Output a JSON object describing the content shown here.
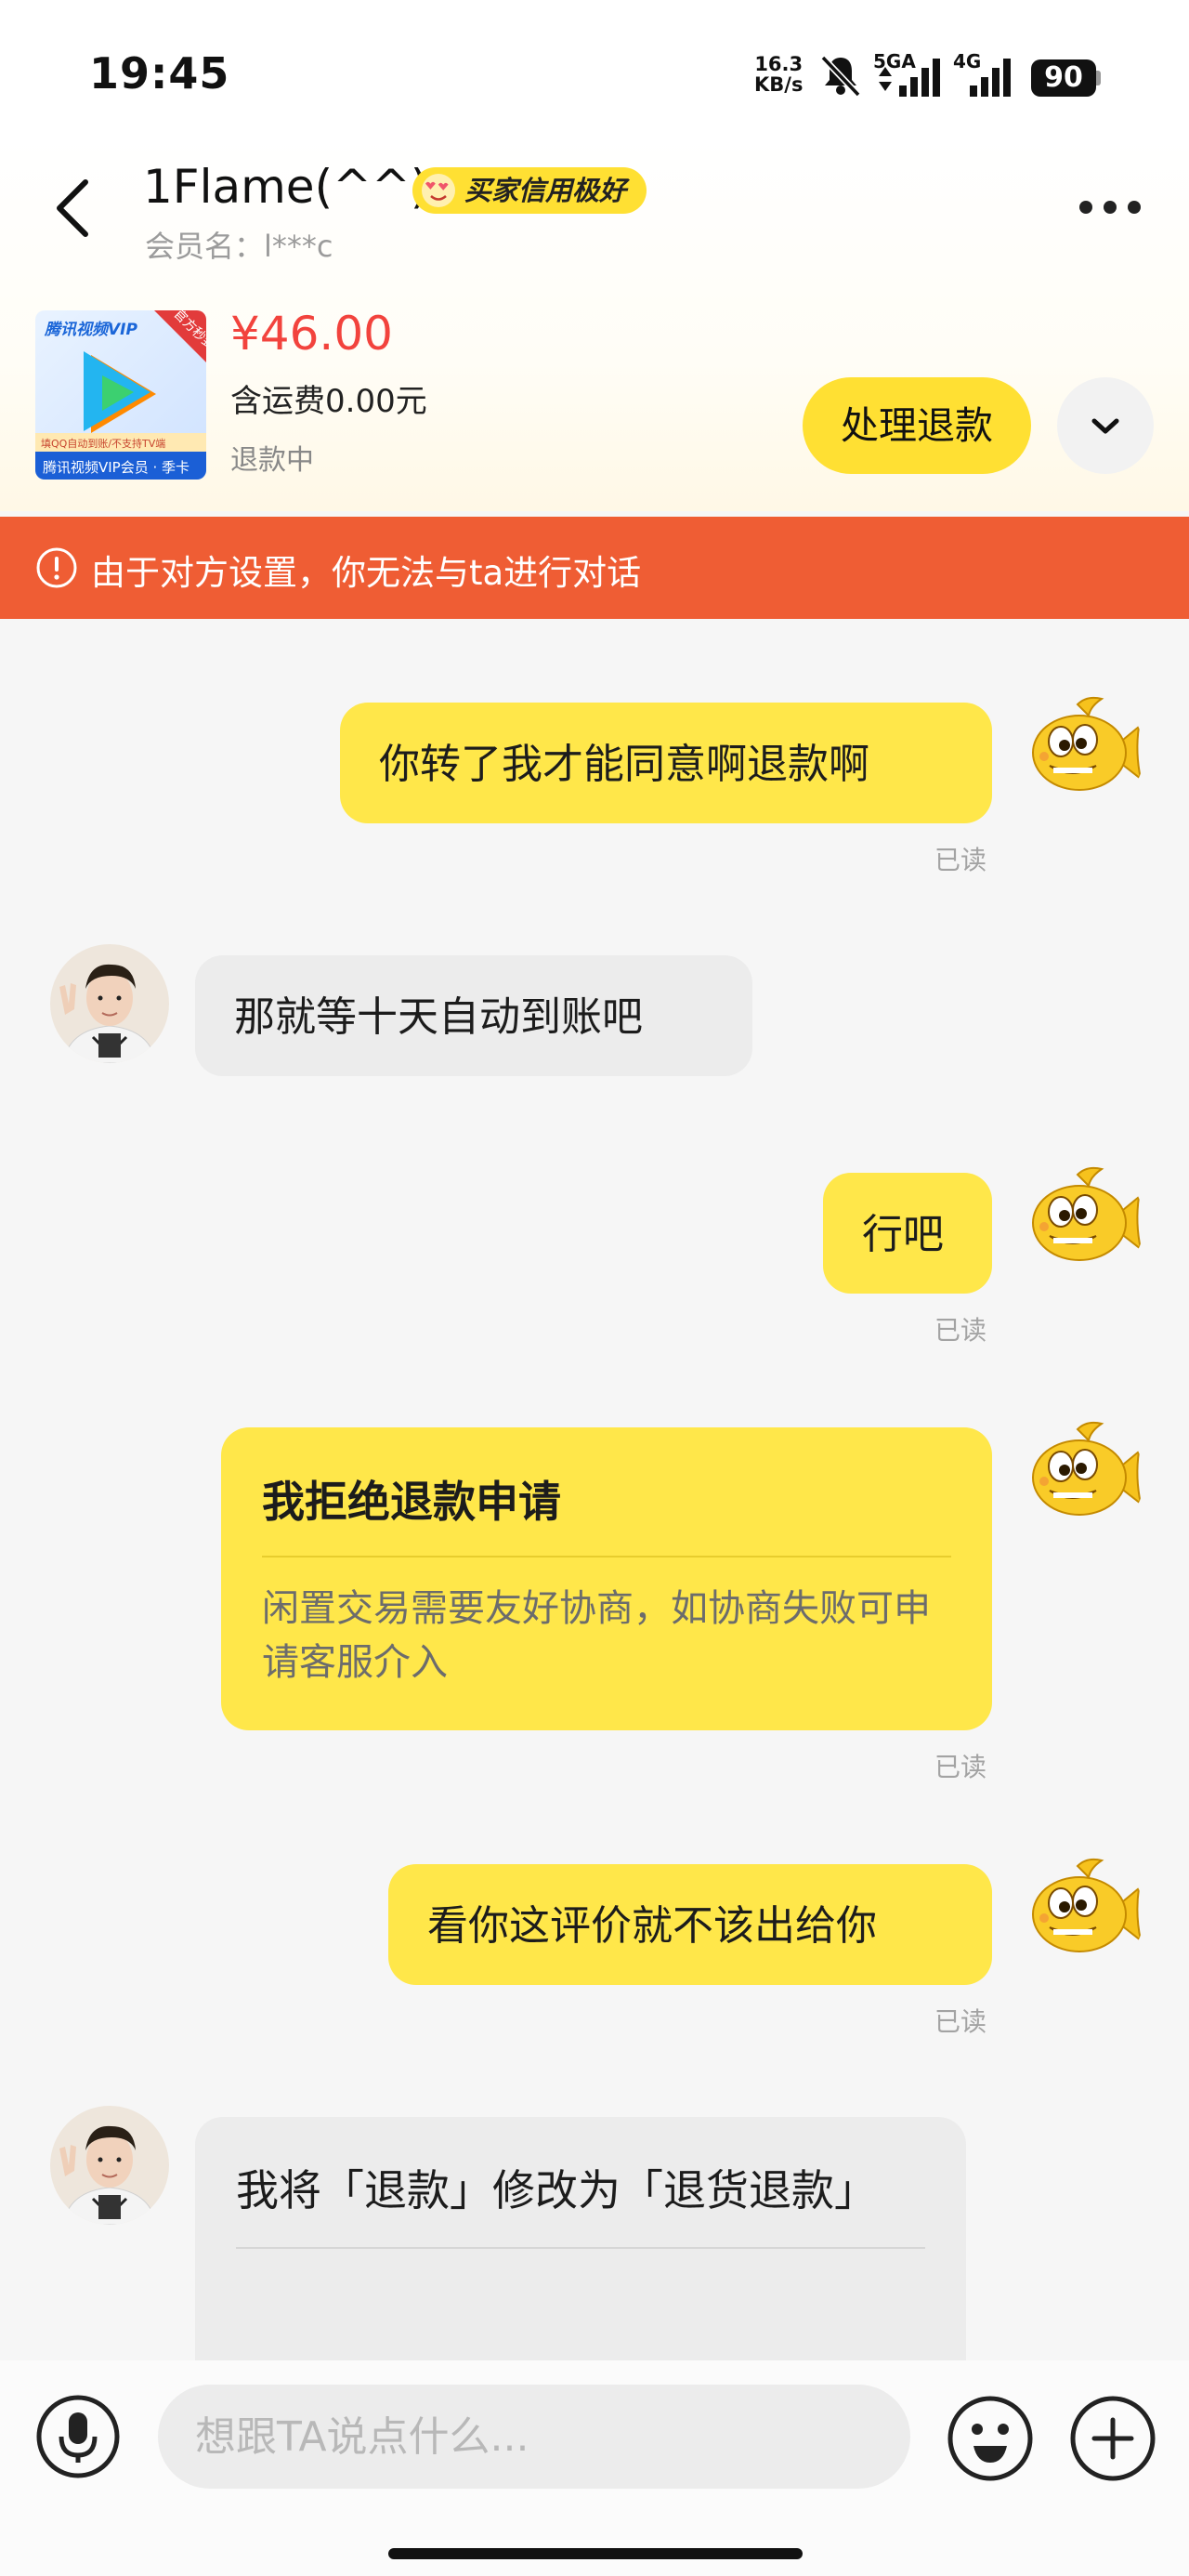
{
  "status_bar": {
    "time": "19:45",
    "net_speed_value": "16.3",
    "net_speed_unit": "KB/s",
    "network_1": "5GA",
    "network_2": "4G",
    "battery": "90"
  },
  "header": {
    "name": "1Flame(^^)",
    "credit_badge": "买家信用极好",
    "member_label": "会员名：l***c"
  },
  "product": {
    "price": "¥46.00",
    "shipping": "含运费0.00元",
    "status": "退款中",
    "thumb_brand": "腾讯视频VIP",
    "thumb_corner": "官方秒到",
    "thumb_note": "填QQ自动到账/不支持TV端",
    "thumb_caption": "腾讯视频VIP会员 · 季卡",
    "handle_button": "处理退款"
  },
  "banner": {
    "text": "由于对方设置，你无法与ta进行对话"
  },
  "messages": {
    "m1": {
      "text": "你转了我才能同意啊退款啊",
      "status": "已读"
    },
    "m2": {
      "text": "那就等十天自动到账吧"
    },
    "m3": {
      "text": "行吧",
      "status": "已读"
    },
    "m4": {
      "title": "我拒绝退款申请",
      "body": "闲置交易需要友好协商，如协商失败可申请客服介入",
      "status": "已读"
    },
    "m5": {
      "text": "看你这评价就不该出给你",
      "status": "已读"
    },
    "m6": {
      "title": "我将「退款」修改为「退货退款」"
    }
  },
  "input": {
    "placeholder": "想跟TA说点什么..."
  },
  "colors": {
    "accent_yellow": "#ffe033",
    "bubble_yellow": "#ffe74a",
    "price_red": "#f2433d",
    "banner_orange": "#ef5d34"
  }
}
